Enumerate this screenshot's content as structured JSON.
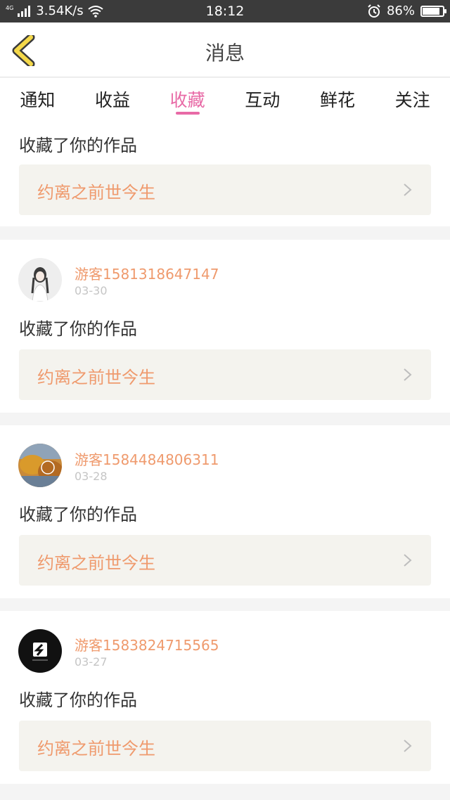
{
  "status": {
    "net_type": "4G",
    "speed": "3.54K/s",
    "time": "18:12",
    "battery": "86%",
    "battery_level": 0.86,
    "icons": [
      "signal-icon",
      "wifi-icon",
      "alarm-icon",
      "battery-icon"
    ]
  },
  "header": {
    "title": "消息",
    "back_icon": "back-chevron-icon"
  },
  "tabs": [
    {
      "label": "通知",
      "active": false
    },
    {
      "label": "收益",
      "active": false
    },
    {
      "label": "收藏",
      "active": true
    },
    {
      "label": "互动",
      "active": false
    },
    {
      "label": "鲜花",
      "active": false
    },
    {
      "label": "关注",
      "active": false
    }
  ],
  "messages": [
    {
      "action": "收藏了你的作品",
      "work_title": "约离之前世今生"
    },
    {
      "user": "游客1581318647147",
      "date": "03-30",
      "action": "收藏了你的作品",
      "work_title": "约离之前世今生"
    },
    {
      "user": "游客1584484806311",
      "date": "03-28",
      "action": "收藏了你的作品",
      "work_title": "约离之前世今生"
    },
    {
      "user": "游客1583824715565",
      "date": "03-27",
      "action": "收藏了你的作品",
      "work_title": "约离之前世今生"
    }
  ],
  "colors": {
    "accent_pink": "#e86aa6",
    "username_orange": "#ef9a6d",
    "back_yellow": "#f4d84a",
    "card_bg": "#f4f3ee"
  }
}
